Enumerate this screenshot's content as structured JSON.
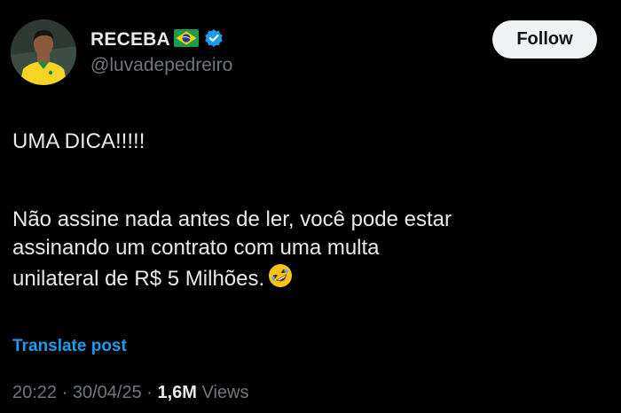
{
  "author": {
    "display_name": "RECEBA",
    "handle": "@luvadepedreiro",
    "flag_icon": "brazil-flag-icon",
    "verified_icon": "verified-badge-icon",
    "verified_color": "#1d9bf0"
  },
  "follow_button": {
    "label": "Follow"
  },
  "post": {
    "lines": [
      "UMA DICA!!!!!",
      "Não assine nada antes de ler, você pode estar",
      "assinando um contrato com uma multa",
      "unilateral de R$ 5 Milhões."
    ],
    "emoji_icon": "rolling-on-floor-laughing-emoji-icon"
  },
  "translate": {
    "label": "Translate post"
  },
  "meta": {
    "time": "20:22",
    "separator": " · ",
    "date": "30/04/25",
    "views_count": "1,6M",
    "views_label": " Views"
  },
  "colors": {
    "background": "#000000",
    "text": "#e7e9ea",
    "muted": "#71767b",
    "link": "#1d9bf0",
    "button_bg": "#eff3f4"
  }
}
